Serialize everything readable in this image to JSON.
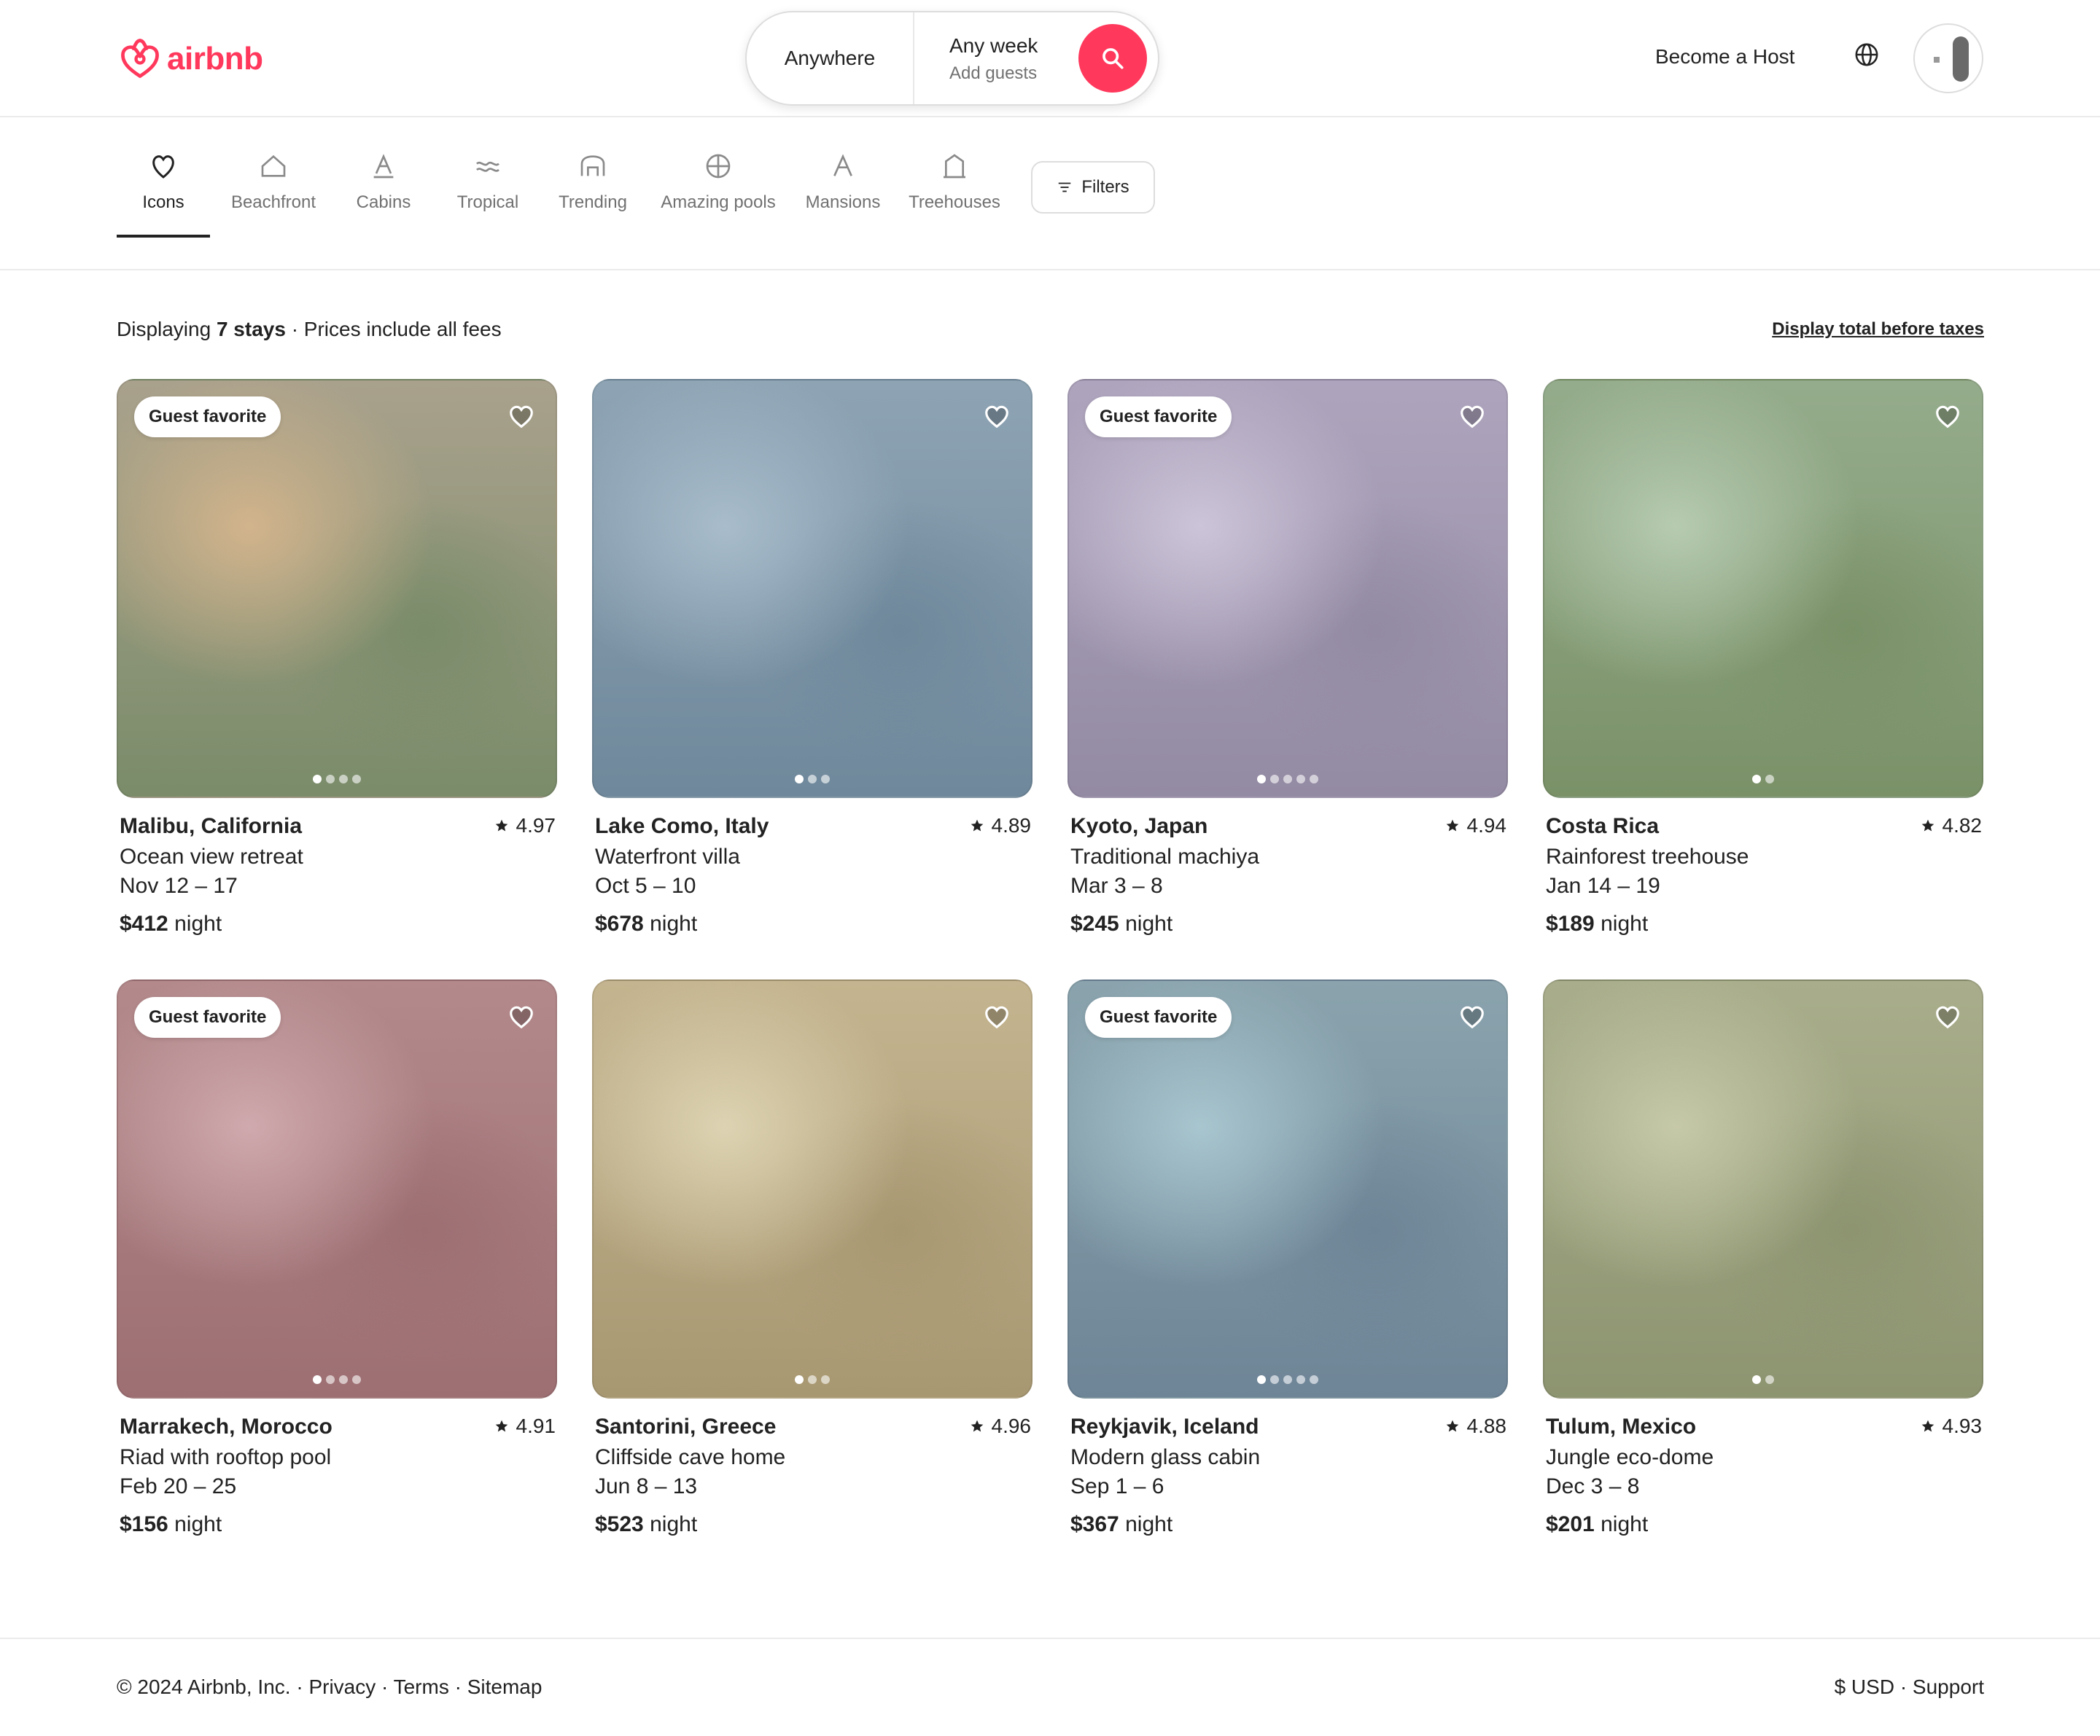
{
  "brand": {
    "name": "airbnb",
    "color": "#ff385c"
  },
  "search": {
    "where": "Anywhere",
    "when": "Any week",
    "who": "Add guests",
    "icon": "search-icon"
  },
  "header": {
    "host_label": "Become a Host",
    "globe_icon": "globe-icon"
  },
  "categories": [
    {
      "label": "Icons",
      "icon": "icons-icon",
      "active": true
    },
    {
      "label": "Beachfront",
      "icon": "beachfront-icon"
    },
    {
      "label": "Cabins",
      "icon": "cabins-icon"
    },
    {
      "label": "Tropical",
      "icon": "tropical-icon"
    },
    {
      "label": "Trending",
      "icon": "trending-icon"
    },
    {
      "label": "Amazing pools",
      "icon": "pools-icon"
    },
    {
      "label": "Mansions",
      "icon": "mansions-icon"
    },
    {
      "label": "Treehouses",
      "icon": "treehouses-icon"
    }
  ],
  "filters_label": "Filters",
  "info": {
    "prefix": "Displaying ",
    "count": "7 stays",
    "suffix": " · Prices include all fees"
  },
  "total_toggle": "Display total before taxes",
  "price_unit": "night",
  "badge_label": "Guest favorite",
  "listings": [
    {
      "location": "Malibu, California",
      "rating": "4.97",
      "title": "Ocean view retreat",
      "dates": "Nov 12 – 17",
      "price": "$412",
      "guest_favorite": true,
      "photos": 4,
      "colors": [
        "#d2b48c",
        "#a9a18c",
        "#7a8c6a"
      ]
    },
    {
      "location": "Lake Como, Italy",
      "rating": "4.89",
      "title": "Waterfront villa",
      "dates": "Oct 5 – 10",
      "price": "$678",
      "guest_favorite": false,
      "photos": 3,
      "colors": [
        "#a8bccb",
        "#8ea4b4",
        "#6f889b"
      ]
    },
    {
      "location": "Kyoto, Japan",
      "rating": "4.94",
      "title": "Traditional machiya",
      "dates": "Mar 3 – 8",
      "price": "$245",
      "guest_favorite": true,
      "photos": 5,
      "colors": [
        "#ccc4d8",
        "#aea4bd",
        "#938aa3"
      ]
    },
    {
      "location": "Costa Rica",
      "rating": "4.82",
      "title": "Rainforest treehouse",
      "dates": "Jan 14 – 19",
      "price": "$189",
      "guest_favorite": false,
      "photos": 2,
      "colors": [
        "#b6cbb0",
        "#95ac8c",
        "#7a9168"
      ]
    },
    {
      "location": "Marrakech, Morocco",
      "rating": "4.91",
      "title": "Riad with rooftop pool",
      "dates": "Feb 20 – 25",
      "price": "$156",
      "guest_favorite": true,
      "photos": 4,
      "colors": [
        "#cfa9ad",
        "#b3898b",
        "#9d6f73"
      ]
    },
    {
      "location": "Santorini, Greece",
      "rating": "4.96",
      "title": "Cliffside cave home",
      "dates": "Jun 8 – 13",
      "price": "$523",
      "guest_favorite": false,
      "photos": 3,
      "colors": [
        "#ddd3b2",
        "#c4b48f",
        "#a89872"
      ]
    },
    {
      "location": "Reykjavik, Iceland",
      "rating": "4.88",
      "title": "Modern glass cabin",
      "dates": "Sep 1 – 6",
      "price": "$367",
      "guest_favorite": true,
      "photos": 5,
      "colors": [
        "#a8c6cf",
        "#8aa3ad",
        "#6e8597"
      ]
    },
    {
      "location": "Tulum, Mexico",
      "rating": "4.93",
      "title": "Jungle eco-dome",
      "dates": "Dec 3 – 8",
      "price": "$201",
      "guest_favorite": false,
      "photos": 2,
      "colors": [
        "#c6c9a8",
        "#a9ad8b",
        "#8d9470"
      ]
    }
  ],
  "footer": {
    "left": "© 2024 Airbnb, Inc. · Privacy · Terms · Sitemap",
    "right": "$ USD · Support"
  }
}
